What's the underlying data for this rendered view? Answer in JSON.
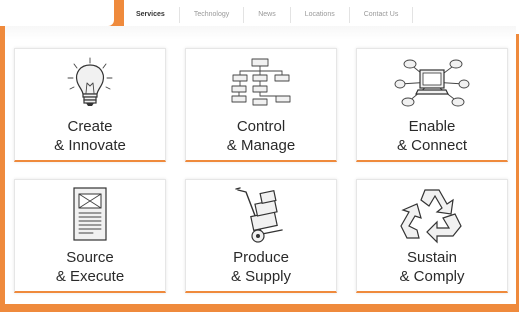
{
  "nav": {
    "items": [
      {
        "label": "Services",
        "active": true
      },
      {
        "label": "Technology",
        "active": false
      },
      {
        "label": "News",
        "active": false
      },
      {
        "label": "Locations",
        "active": false
      },
      {
        "label": "Contact Us",
        "active": false
      }
    ]
  },
  "tiles": [
    {
      "line1": "Create",
      "line2": "& Innovate",
      "icon": "lightbulb-icon"
    },
    {
      "line1": "Control",
      "line2": "& Manage",
      "icon": "flowchart-icon"
    },
    {
      "line1": "Enable",
      "line2": "& Connect",
      "icon": "network-computer-icon"
    },
    {
      "line1": "Source",
      "line2": "& Execute",
      "icon": "document-icon"
    },
    {
      "line1": "Produce",
      "line2": "& Supply",
      "icon": "hand-truck-icon"
    },
    {
      "line1": "Sustain",
      "line2": "& Comply",
      "icon": "recycle-icon"
    }
  ],
  "colors": {
    "accent": "#ef8a3c",
    "text": "#2a2a2a",
    "nav_text": "#999999"
  }
}
